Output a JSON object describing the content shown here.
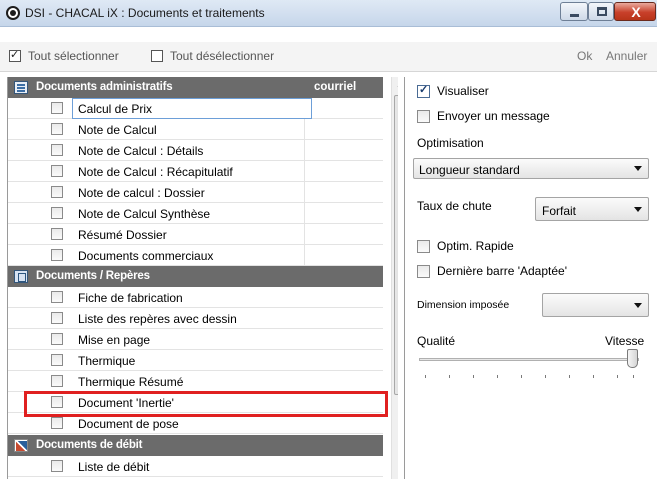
{
  "window": {
    "title": "DSI - CHACAL iX : Documents et traitements",
    "close_glyph": "X"
  },
  "toolbar": {
    "select_all": "Tout sélectionner",
    "deselect_all": "Tout désélectionner",
    "ok": "Ok",
    "cancel": "Annuler"
  },
  "sections": {
    "admin": {
      "title": "Documents administratifs",
      "column": "courriel",
      "items": [
        "Calcul de Prix",
        "Note de Calcul",
        "Note de Calcul : Détails",
        "Note de Calcul : Récapitulatif",
        "Note de calcul : Dossier",
        "Note de Calcul Synthèse",
        "Résumé Dossier",
        "Documents commerciaux"
      ]
    },
    "reperes": {
      "title": "Documents / Repères",
      "items": [
        "Fiche de fabrication",
        "Liste des repères avec dessin",
        "Mise en page",
        "Thermique",
        "Thermique Résumé",
        "Document 'Inertie'",
        "Document de pose"
      ]
    },
    "debit": {
      "title": "Documents de débit",
      "items": [
        "Liste de débit"
      ]
    }
  },
  "options": {
    "visualiser": {
      "label": "Visualiser",
      "checked": true
    },
    "envoyer": {
      "label": "Envoyer un message",
      "checked": false
    },
    "optimisation_label": "Optimisation",
    "optimisation_value": "Longueur standard",
    "taux_label": "Taux de chute",
    "taux_value": "Forfait",
    "optim_rapide": {
      "label": "Optim. Rapide",
      "checked": false
    },
    "derniere_barre": {
      "label": "Dernière barre 'Adaptée'",
      "checked": false
    },
    "dimension_label": "Dimension imposée",
    "dimension_value": "",
    "qualite_label": "Qualité",
    "vitesse_label": "Vitesse",
    "slider_value_fraction": 1.0
  },
  "colors": {
    "section_header": "#6b6b6b",
    "highlight": "#e02020",
    "selection_border": "#6d9fd8"
  }
}
